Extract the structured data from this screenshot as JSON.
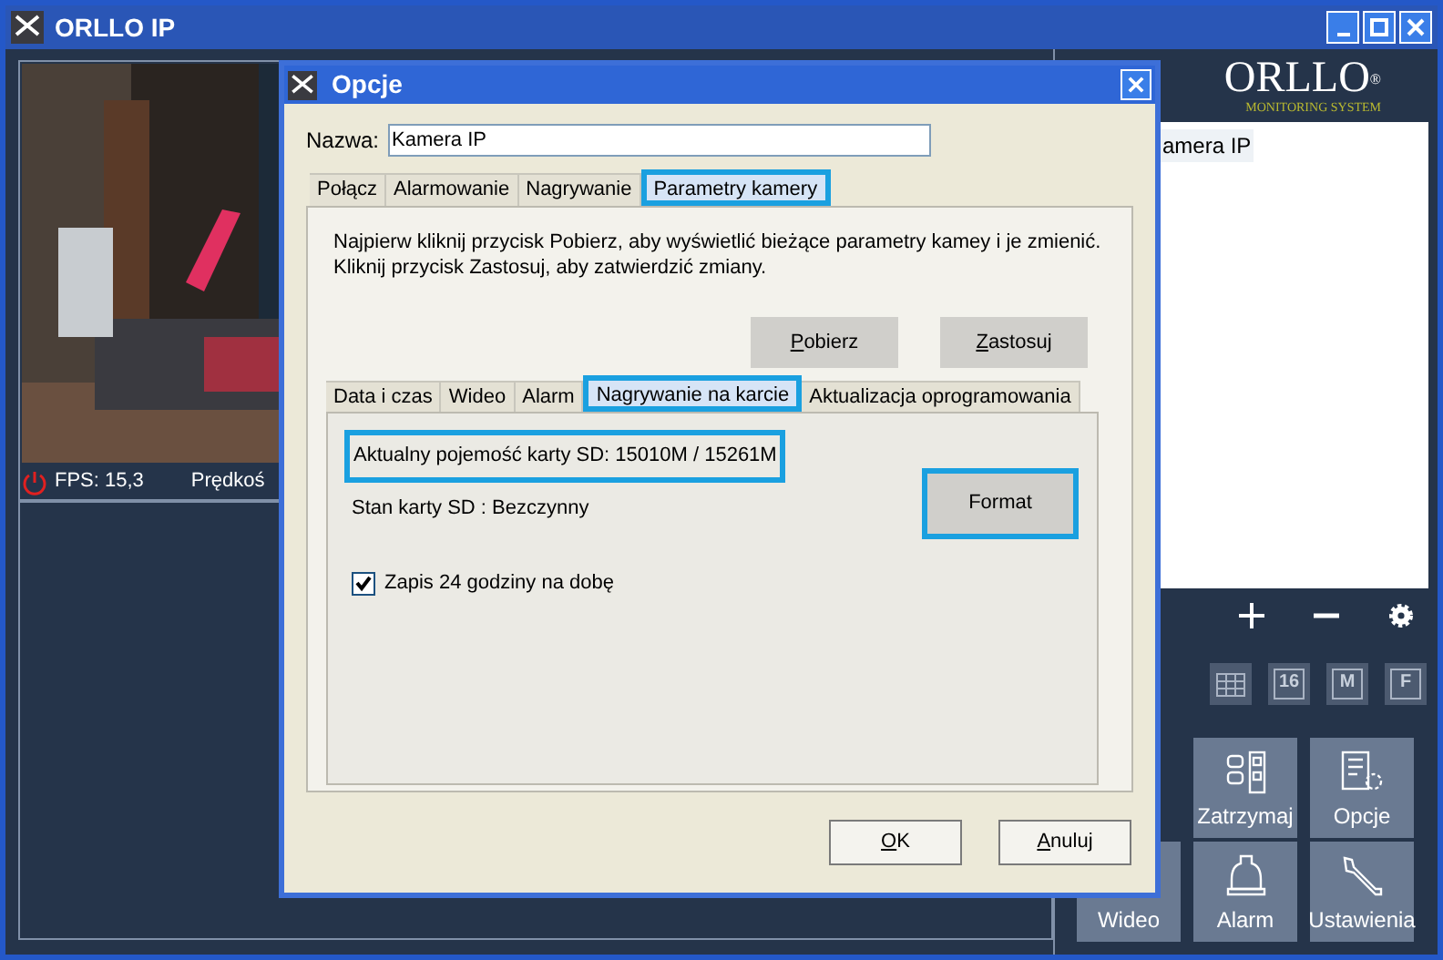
{
  "window": {
    "title": "ORLLO IP"
  },
  "camera_view": {
    "kind": "picture",
    "fps": "FPS: 15,3",
    "speed": "Prędkoś"
  },
  "logo": {
    "brand": "ORLLO",
    "registered": "®",
    "tagline": "MONITORING SYSTEM"
  },
  "camera_list": [
    {
      "label": "amera IP"
    }
  ],
  "controls": [
    {
      "kind": "plus"
    },
    {
      "kind": "minus"
    },
    {
      "kind": "gear"
    }
  ],
  "layout_buttons": [
    {
      "kind": "grid"
    },
    {
      "kind": "text",
      "label": "16"
    },
    {
      "kind": "text",
      "label": "M"
    },
    {
      "kind": "text",
      "label": "F"
    }
  ],
  "action_buttons": [
    {
      "kind": "stop",
      "label": "Zatrzymaj"
    },
    {
      "kind": "options",
      "label": "Opcje"
    },
    {
      "kind": "none",
      "label": "Wideo"
    },
    {
      "kind": "alarm",
      "label": "Alarm"
    },
    {
      "kind": "settings",
      "label": "Ustawienia"
    }
  ],
  "dialog": {
    "title": "Opcje",
    "name_label": "Nazwa:",
    "name_value": "Kamera IP",
    "tabs": [
      {
        "label": "Połącz",
        "selected": false,
        "highlighted": false
      },
      {
        "label": "Alarmowanie",
        "selected": false,
        "highlighted": false
      },
      {
        "label": "Nagrywanie",
        "selected": false,
        "highlighted": false
      },
      {
        "label": "Parametry kamery",
        "selected": true,
        "highlighted": true
      }
    ],
    "instructions": [
      "Najpierw kliknij przycisk Pobierz, aby wyświetlić bieżące parametry kamey i  je zmienić.",
      "Kliknij przycisk Zastosuj, aby zatwierdzić zmiany."
    ],
    "top_buttons": [
      {
        "label": "Pobierz",
        "mnemonic": true
      },
      {
        "label": "Zastosuj",
        "mnemonic": true
      }
    ],
    "sub_tabs": [
      {
        "label": "Data i czas",
        "selected": false,
        "highlighted": false
      },
      {
        "label": "Wideo",
        "selected": false,
        "highlighted": false
      },
      {
        "label": "Alarm",
        "selected": false,
        "highlighted": false
      },
      {
        "label": "Nagrywanie na karcie",
        "selected": true,
        "highlighted": true
      },
      {
        "label": "Aktualizacja oprogramowania",
        "selected": false,
        "highlighted": false
      }
    ],
    "capacity": {
      "text": "Aktualny pojemość karty SD: 15010M / 15261M",
      "highlighted": true
    },
    "status": "Stan karty SD : Bezczynny",
    "format_button": {
      "label": "Format",
      "highlighted": true
    },
    "record_24h": {
      "label": "Zapis 24 godziny na dobę",
      "checked": true
    },
    "footer_buttons": [
      {
        "label": "OK",
        "mnemonic": true
      },
      {
        "label": "Anuluj",
        "mnemonic": true
      }
    ]
  }
}
